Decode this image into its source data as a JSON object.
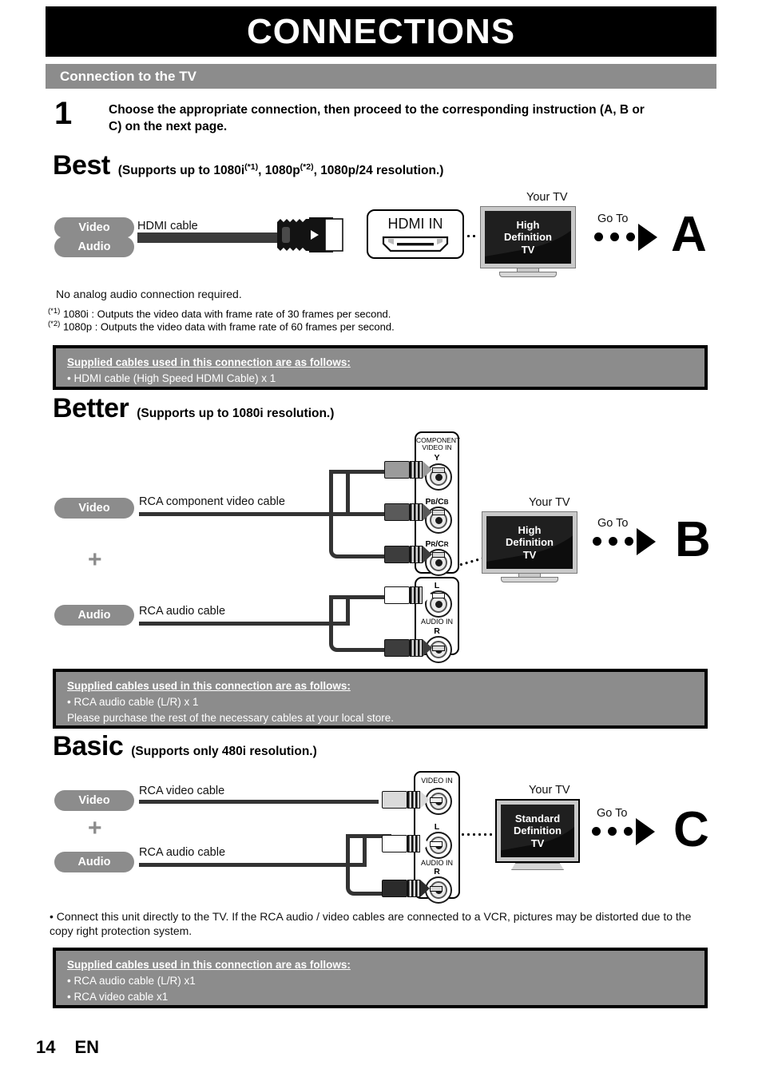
{
  "header": {
    "title": "CONNECTIONS",
    "section_title": "Connection to the TV"
  },
  "step": {
    "number": "1",
    "text": "Choose the appropriate connection, then proceed to the corresponding instruction (A, B or C) on the next page."
  },
  "best": {
    "grade": "Best",
    "subtitle_pre": "(Supports up to 1080i",
    "sup1": "(*1)",
    "subtitle_mid": ", 1080p",
    "sup2": "(*2)",
    "subtitle_post": ", 1080p/24 resolution.)",
    "pill_video": "Video",
    "pill_audio": "Audio",
    "cable_label": "HDMI cable",
    "port_label": "HDMI IN",
    "tv_caption": "Your TV",
    "tv_line1": "High",
    "tv_line2": "Definition",
    "tv_line3": "TV",
    "goto": "Go To",
    "letter": "A",
    "note_analog": "No analog audio connection required.",
    "footnote1_mark": "(*1)",
    "footnote1_text": "1080i  : Outputs the video data with frame rate of 30 frames per second.",
    "footnote2_mark": "(*2)",
    "footnote2_text": "1080p : Outputs the video data with frame rate of 60 frames per second.",
    "supplied_title": "Supplied cables used in this connection are as follows:",
    "supplied_line1": "• HDMI cable (High Speed HDMI Cable) x 1"
  },
  "better": {
    "grade": "Better",
    "subtitle": "(Supports up to 1080i resolution.)",
    "pill_video": "Video",
    "pill_audio": "Audio",
    "plus": "+",
    "video_cable_label": "RCA component video cable",
    "audio_cable_label": "RCA audio cable",
    "panel_title_line1": "COMPONENT",
    "panel_title_line2": "VIDEO IN",
    "jack_y": "Y",
    "jack_pb": "PB/CB",
    "jack_pr": "PR/CR",
    "jack_l": "L",
    "audio_in": "AUDIO IN",
    "jack_r": "R",
    "tv_caption": "Your TV",
    "tv_line1": "High",
    "tv_line2": "Definition",
    "tv_line3": "TV",
    "goto": "Go To",
    "letter": "B",
    "supplied_title": "Supplied cables used in this connection are as follows:",
    "supplied_line1": "• RCA audio cable (L/R) x 1",
    "supplied_line2": "Please purchase the rest of the necessary cables at your local store."
  },
  "basic": {
    "grade": "Basic",
    "subtitle": "(Supports only 480i resolution.)",
    "pill_video": "Video",
    "pill_audio": "Audio",
    "plus": "+",
    "video_cable_label": "RCA video cable",
    "audio_cable_label": "RCA audio cable",
    "video_in": "VIDEO IN",
    "jack_l": "L",
    "audio_in": "AUDIO IN",
    "jack_r": "R",
    "tv_caption": "Your TV",
    "tv_line1": "Standard",
    "tv_line2": "Definition",
    "tv_line3": "TV",
    "goto": "Go To",
    "letter": "C",
    "bullet_note": "• Connect this unit directly to the TV. If the RCA audio / video cables are connected to a VCR, pictures may be distorted due to the copy right protection system.",
    "supplied_title": "Supplied cables used in this connection are as follows:",
    "supplied_line1": "• RCA audio cable (L/R) x1",
    "supplied_line2": "• RCA video cable x1"
  },
  "footer": {
    "page_number": "14",
    "language": "EN"
  },
  "colors": {
    "gray_bar": "#8c8c8c",
    "black": "#000000",
    "tv_bezel": "#c9c9c9",
    "screen": "#0d0d0d"
  }
}
